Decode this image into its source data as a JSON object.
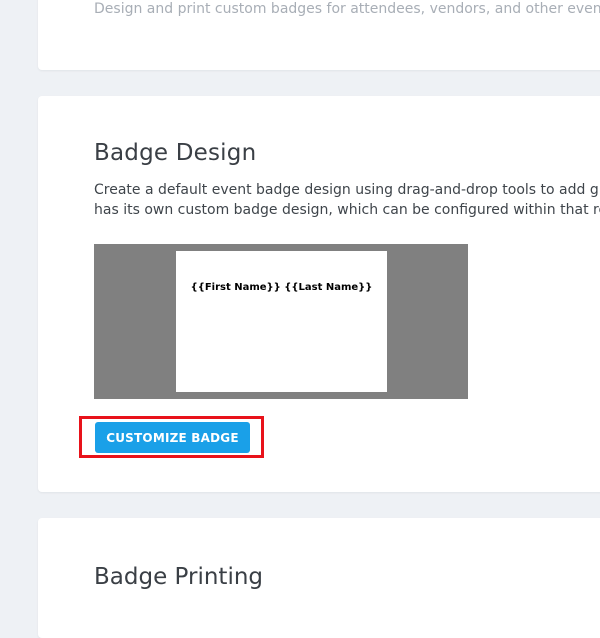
{
  "top_card": {
    "description": "Design and print custom badges for attendees, vendors, and other event p"
  },
  "badge_design": {
    "title": "Badge Design",
    "description_lines": [
      "Create a default event badge design using drag-and-drop tools to add gra",
      "has its own custom badge design, which can be configured within that reg"
    ],
    "preview": {
      "name_placeholder": "{{First Name}} {{Last Name}}"
    },
    "customize_button_label": "CUSTOMIZE BADGE"
  },
  "badge_printing": {
    "title": "Badge Printing"
  },
  "colors": {
    "page_background": "#eef1f5",
    "card_background": "#ffffff",
    "preview_background": "#808080",
    "button_primary": "#1aa0e8",
    "highlight_outline": "#e8121a",
    "muted_text": "#a8aeb6"
  }
}
